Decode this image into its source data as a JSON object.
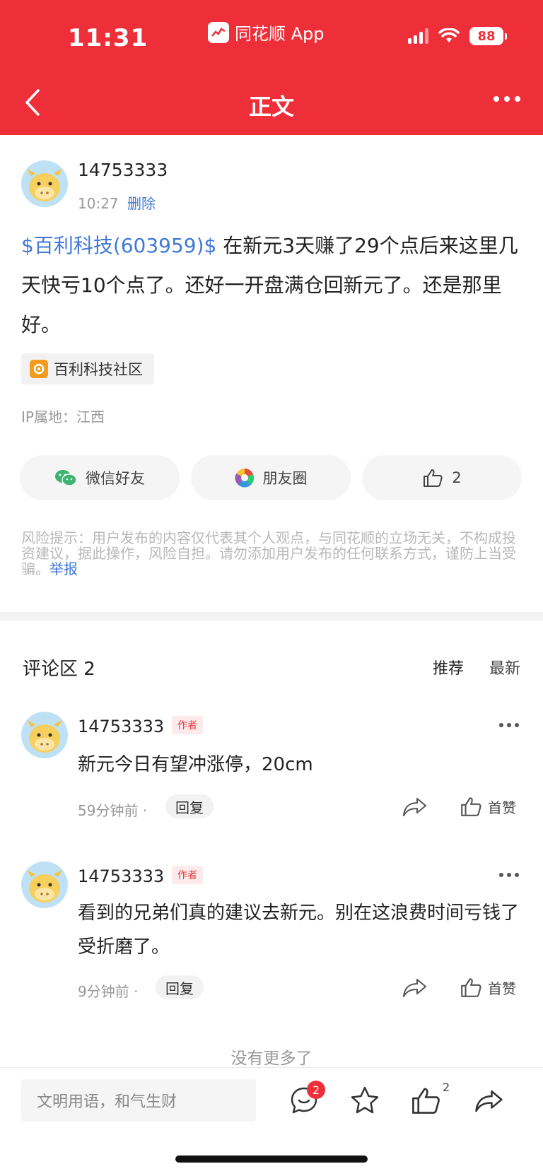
{
  "status_bar": {
    "time": "11:31",
    "app_name": "同花顺 App",
    "battery": "88"
  },
  "nav": {
    "title": "正文"
  },
  "post": {
    "author": "14753333",
    "time": "10:27",
    "delete_label": "删除",
    "stock_link": "$百利科技(603959)$",
    "body_text": " 在新元3天赚了29个点后来这里几天快亏10个点了。还好一开盘满仓回新元了。还是那里好。",
    "community_tag": "百利科技社区",
    "ip_location": "IP属地：江西"
  },
  "share": {
    "wechat": "微信好友",
    "moments": "朋友圈",
    "like_count": "2"
  },
  "risk_notice": {
    "text": "风险提示：用户发布的内容仅代表其个人观点，与同花顺的立场无关，不构成投资建议，据此操作，风险自担。请勿添加用户发布的任何联系方式，谨防上当受骗。",
    "report_label": "举报"
  },
  "comments": {
    "title": "评论区 2",
    "sort_recommend": "推荐",
    "sort_latest": "最新",
    "items": [
      {
        "author": "14753333",
        "badge": "作者",
        "text": "新元今日有望冲涨停，20cm",
        "time": "59分钟前 ·",
        "reply": "回复",
        "like": "首赞"
      },
      {
        "author": "14753333",
        "badge": "作者",
        "text": "看到的兄弟们真的建议去新元。别在这浪费时间亏钱了受折磨了。",
        "time": "9分钟前 ·",
        "reply": "回复",
        "like": "首赞"
      }
    ],
    "no_more": "没有更多了"
  },
  "bottom_bar": {
    "input_placeholder": "文明用语，和气生财",
    "comment_badge": "2",
    "like_count": "2"
  },
  "colors": {
    "brand_red": "#ee2f3a",
    "link_blue": "#3f78d8"
  },
  "icons": [
    "back-icon",
    "more-icon",
    "wechat-icon",
    "moments-icon",
    "thumb-up-icon",
    "share-arrow-icon",
    "comment-icon",
    "star-icon"
  ]
}
